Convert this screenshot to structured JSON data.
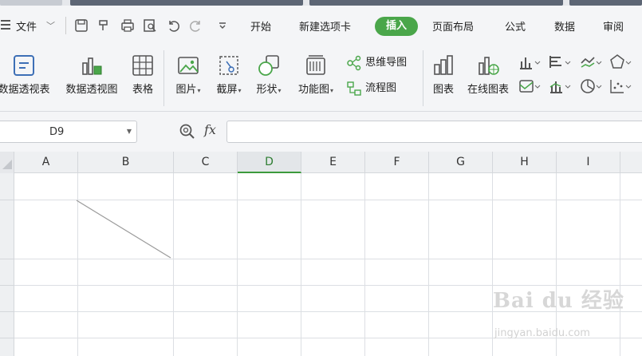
{
  "menu": {
    "file_label": "文件",
    "tabs": [
      "开始",
      "新建选项卡",
      "插入",
      "页面布局",
      "公式",
      "数据",
      "审阅"
    ],
    "active_tab": "插入"
  },
  "ribbon": {
    "pivot_table": "数据透视表",
    "pivot_chart": "数据透视图",
    "table": "表格",
    "picture": "图片",
    "screenshot": "截屏",
    "shapes": "形状",
    "function_chart": "功能图",
    "mindmap": "思维导图",
    "flowchart": "流程图",
    "chart": "图表",
    "online_chart": "在线图表"
  },
  "formula_bar": {
    "name_box": "D9",
    "fx_label": "fx",
    "formula_value": ""
  },
  "sheet": {
    "columns": [
      "A",
      "B",
      "C",
      "D",
      "E",
      "F",
      "G",
      "H",
      "I"
    ],
    "active_column": "D"
  },
  "watermark": {
    "brand": "Bai du 经验",
    "url": "jingyan.baidu.com"
  },
  "colors": {
    "accent_green": "#4aa64a",
    "active_col_text": "#2e7d32"
  }
}
